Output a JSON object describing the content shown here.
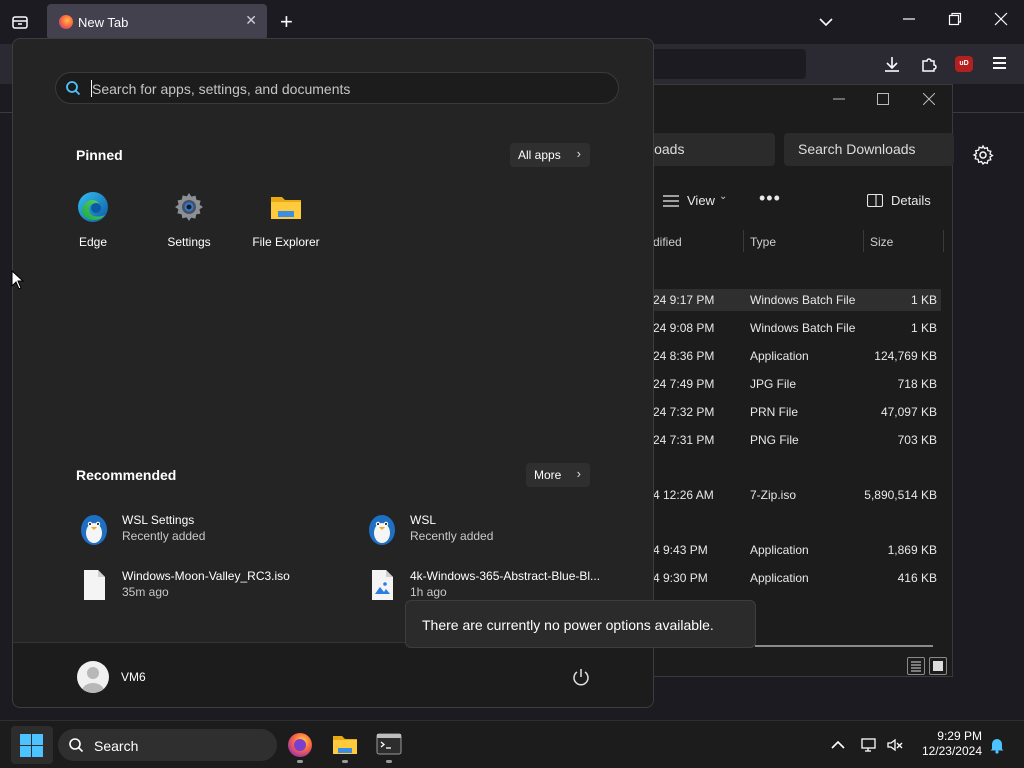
{
  "browser": {
    "tab_title": "New Tab",
    "close_symbol": "✕",
    "new_tab_symbol": "+"
  },
  "explorer": {
    "address_text": "loads",
    "search_placeholder": "Search Downloads",
    "view_label": "View",
    "more_label": "•••",
    "details_label": "Details",
    "columns": {
      "modified": "dified",
      "type": "Type",
      "size": "Size"
    },
    "files": [
      {
        "modified": "24 9:17 PM",
        "type": "Windows Batch File",
        "size": "1 KB"
      },
      {
        "modified": "24 9:08 PM",
        "type": "Windows Batch File",
        "size": "1 KB"
      },
      {
        "modified": "24 8:36 PM",
        "type": "Application",
        "size": "124,769 KB"
      },
      {
        "modified": "24 7:49 PM",
        "type": "JPG File",
        "size": "718 KB"
      },
      {
        "modified": "24 7:32 PM",
        "type": "PRN File",
        "size": "47,097 KB"
      },
      {
        "modified": "24 7:31 PM",
        "type": "PNG File",
        "size": "703 KB"
      },
      {
        "modified": "4 12:26 AM",
        "type": "7-Zip.iso",
        "size": "5,890,514 KB"
      },
      {
        "modified": "4 9:43 PM",
        "type": "Application",
        "size": "1,869 KB"
      },
      {
        "modified": "4 9:30 PM",
        "type": "Application",
        "size": "416 KB"
      }
    ]
  },
  "start_menu": {
    "search_placeholder": "Search for apps, settings, and documents",
    "pinned_heading": "Pinned",
    "all_apps_label": "All apps",
    "pinned": [
      {
        "label": "Edge",
        "icon": "edge-icon"
      },
      {
        "label": "Settings",
        "icon": "settings-gear-icon"
      },
      {
        "label": "File Explorer",
        "icon": "folder-icon"
      }
    ],
    "recommended_heading": "Recommended",
    "more_label": "More",
    "recommended": [
      {
        "name": "WSL Settings",
        "sub": "Recently added",
        "icon": "penguin-icon"
      },
      {
        "name": "WSL",
        "sub": "Recently added",
        "icon": "penguin-icon"
      },
      {
        "name": "Windows-Moon-Valley_RC3.iso",
        "sub": "35m ago",
        "icon": "file-icon"
      },
      {
        "name": "4k-Windows-365-Abstract-Blue-Bl...",
        "sub": "1h ago",
        "icon": "image-file-icon"
      }
    ],
    "user_name": "VM6"
  },
  "tooltip": "There are currently no power options available.",
  "taskbar": {
    "search_label": "Search",
    "time": "9:29 PM",
    "date": "12/23/2024"
  },
  "colors": {
    "accent": "#4cc2ff",
    "menu_bg": "#242424",
    "taskbar_bg": "#1c1c1c"
  }
}
